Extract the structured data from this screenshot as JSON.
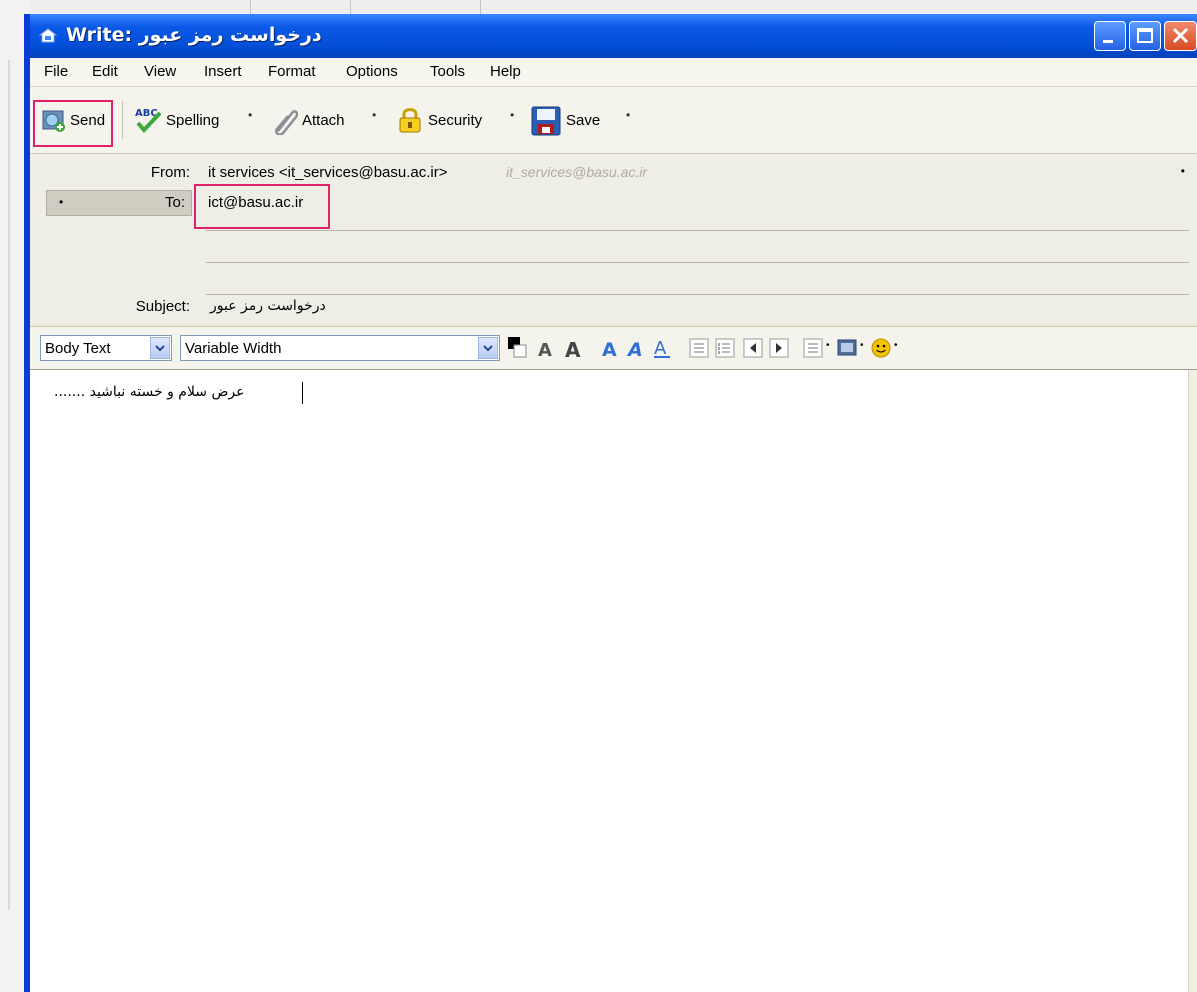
{
  "window": {
    "title": "Write: درخواست رمز عبور"
  },
  "menu": [
    "File",
    "Edit",
    "View",
    "Insert",
    "Format",
    "Options",
    "Tools",
    "Help"
  ],
  "toolbar": {
    "send": "Send",
    "spelling": "Spelling",
    "attach": "Attach",
    "security": "Security",
    "save": "Save"
  },
  "header": {
    "from_label": "From:",
    "from_value": "it services <it_services@basu.ac.ir>",
    "from_hint": "it_services@basu.ac.ir",
    "to_label": "To:",
    "to_value": "ict@basu.ac.ir",
    "subject_label": "Subject:",
    "subject_value": "درخواست رمز عبور"
  },
  "format": {
    "paragraph_style": "Body Text",
    "font": "Variable Width"
  },
  "body": {
    "text": "عرض سلام و خسته نباشید ......."
  },
  "colors": {
    "highlight": "#e0216c",
    "titlebar": "#0a58e6"
  }
}
